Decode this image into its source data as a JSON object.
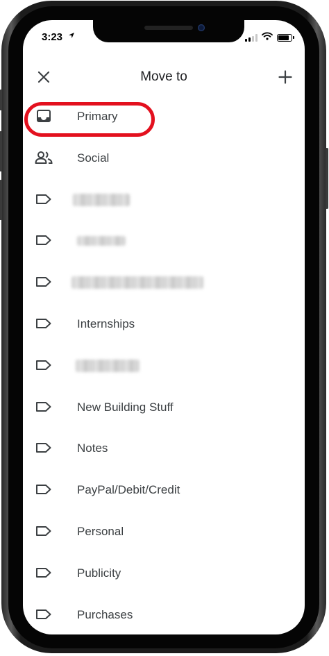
{
  "status_bar": {
    "time": "3:23",
    "location_icon": "location-arrow-icon",
    "signal_icon": "cellular-signal-icon",
    "wifi_icon": "wifi-icon",
    "battery_icon": "battery-icon"
  },
  "header": {
    "close_icon": "close-icon",
    "title": "Move to",
    "add_icon": "plus-icon"
  },
  "items": [
    {
      "label": "Primary",
      "icon": "inbox-icon",
      "highlighted": true
    },
    {
      "label": "Social",
      "icon": "people-icon"
    },
    {
      "label": "",
      "icon": "label-tag-icon",
      "redacted": true
    },
    {
      "label": "",
      "icon": "label-tag-icon",
      "redacted": true
    },
    {
      "label": "",
      "icon": "label-tag-icon",
      "redacted": true
    },
    {
      "label": "Internships",
      "icon": "label-tag-icon"
    },
    {
      "label": "",
      "icon": "label-tag-icon",
      "redacted": true
    },
    {
      "label": "New Building Stuff",
      "icon": "label-tag-icon"
    },
    {
      "label": "Notes",
      "icon": "label-tag-icon"
    },
    {
      "label": "PayPal/Debit/Credit",
      "icon": "label-tag-icon"
    },
    {
      "label": "Personal",
      "icon": "label-tag-icon"
    },
    {
      "label": "Publicity",
      "icon": "label-tag-icon"
    },
    {
      "label": "Purchases",
      "icon": "label-tag-icon"
    }
  ],
  "colors": {
    "highlight_ring": "#e3101e",
    "text": "#3c4043",
    "icon": "#3c4043"
  }
}
